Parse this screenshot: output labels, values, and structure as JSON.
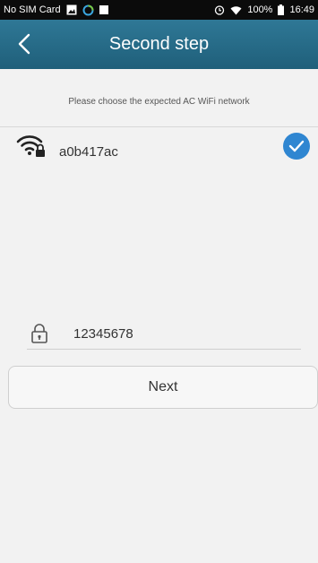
{
  "status_bar": {
    "carrier": "No SIM Card",
    "battery": "100%",
    "time": "16:49"
  },
  "header": {
    "title": "Second step"
  },
  "hint": "Please choose the expected AC WiFi network",
  "networks": [
    {
      "ssid": "a0b417ac",
      "selected": true
    }
  ],
  "password": {
    "value": "12345678"
  },
  "next_label": "Next",
  "colors": {
    "header_top": "#2f7896",
    "header_bottom": "#1f5f7a",
    "check_blue": "#2f86d1",
    "background": "#f2f2f2"
  }
}
